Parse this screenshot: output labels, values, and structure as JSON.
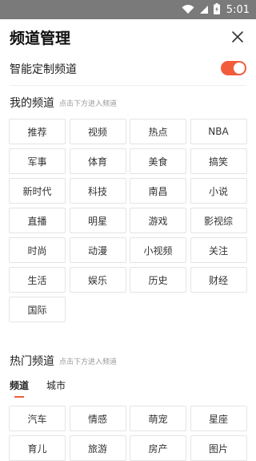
{
  "status_bar": {
    "time": "5:01",
    "icons": [
      "wifi-icon",
      "signal-icon",
      "battery-icon"
    ]
  },
  "header": {
    "title": "频道管理",
    "close_icon": "close-icon"
  },
  "smart": {
    "label": "智能定制频道",
    "toggle_on": true,
    "accent": "#f25c3b"
  },
  "my_channels": {
    "title": "我的频道",
    "hint": "点击下方进入频道",
    "items": [
      "推荐",
      "视频",
      "热点",
      "NBA",
      "军事",
      "体育",
      "美食",
      "搞笑",
      "新时代",
      "科技",
      "南昌",
      "小说",
      "直播",
      "明星",
      "游戏",
      "影视综",
      "时尚",
      "动漫",
      "小视频",
      "关注",
      "生活",
      "娱乐",
      "历史",
      "财经",
      "国际"
    ]
  },
  "hot_channels": {
    "title": "热门频道",
    "hint": "点击下方进入频道",
    "tabs": [
      {
        "label": "频道",
        "active": true
      },
      {
        "label": "城市",
        "active": false
      }
    ],
    "items": [
      "汽车",
      "情感",
      "萌宠",
      "星座",
      "育儿",
      "旅游",
      "房产",
      "图片"
    ]
  }
}
